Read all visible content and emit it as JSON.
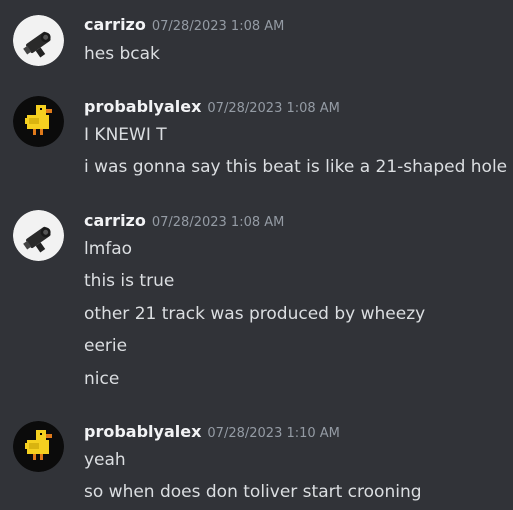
{
  "messages": [
    {
      "username": "carrizo",
      "timestamp": "07/28/2023 1:08 AM",
      "avatar_icon": "camera-avatar-icon",
      "lines": [
        "hes bcak"
      ]
    },
    {
      "username": "probablyalex",
      "timestamp": "07/28/2023 1:08 AM",
      "avatar_icon": "duck-avatar-icon",
      "lines": [
        "I KNEWI T",
        "i was gonna say this beat is like a 21-shaped hole"
      ]
    },
    {
      "username": "carrizo",
      "timestamp": "07/28/2023 1:08 AM",
      "avatar_icon": "camera-avatar-icon",
      "lines": [
        "lmfao",
        "this is true",
        "other 21 track was produced by wheezy",
        "eerie",
        "nice"
      ]
    },
    {
      "username": "probablyalex",
      "timestamp": "07/28/2023 1:10 AM",
      "avatar_icon": "duck-avatar-icon",
      "lines": [
        "yeah",
        "so when does don toliver start crooning"
      ]
    }
  ],
  "colors": {
    "background": "#313338",
    "username": "#f2f3f5",
    "timestamp": "#949ba4",
    "text": "#dbdee1",
    "duck_yellow": "#f5d020"
  }
}
